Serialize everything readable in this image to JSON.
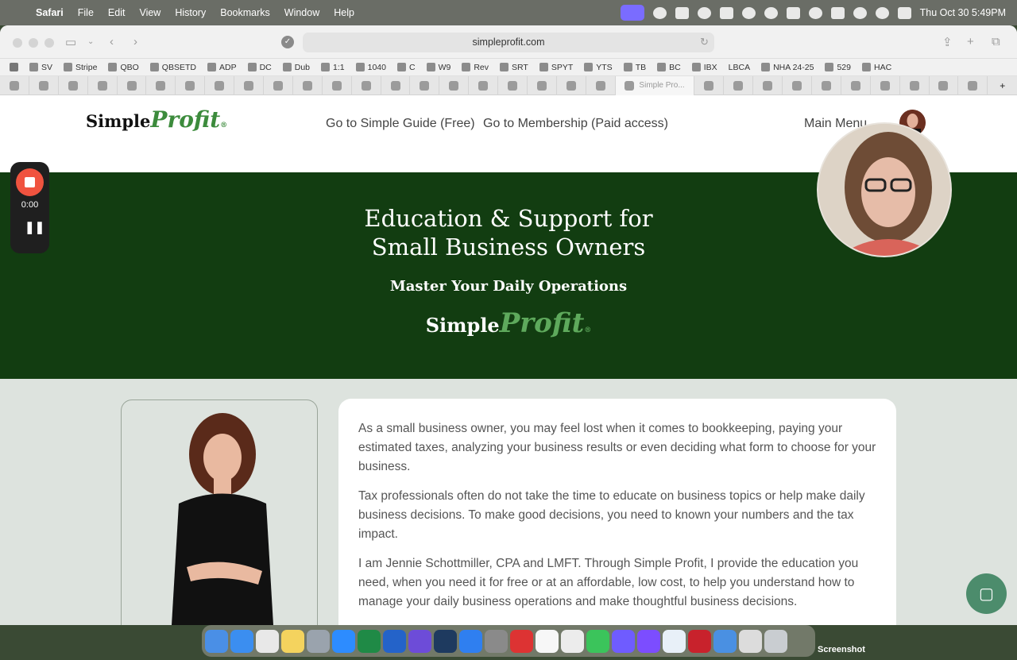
{
  "menubar": {
    "app_name": "Safari",
    "menus": [
      "File",
      "Edit",
      "View",
      "History",
      "Bookmarks",
      "Window",
      "Help"
    ],
    "clock": "Thu Oct 30  5:49PM"
  },
  "browser": {
    "url": "simpleprofit.com",
    "bookmarks": [
      "SV",
      "Stripe",
      "QBO",
      "QBSETD",
      "ADP",
      "DC",
      "Dub",
      "1:1",
      "1040",
      "C",
      "W9",
      "Rev",
      "SRT",
      "SPYT",
      "YTS",
      "TB",
      "BC",
      "IBX",
      "LBCA",
      "NHA 24-25",
      "529",
      "HAC"
    ],
    "active_tab_label": "Simple Pro..."
  },
  "site": {
    "logo_part1": "Simple",
    "logo_part2": "Profit",
    "logo_reg": "®",
    "nav_guide": "Go to Simple Guide (Free)",
    "nav_membership": "Go to Membership (Paid access)",
    "nav_main_menu": "Main Menu"
  },
  "hero": {
    "title_line1": "Education & Support for",
    "title_line2": "Small Business Owners",
    "subtitle": "Master Your Daily Operations"
  },
  "intro": {
    "paragraphs": [
      "As a small business owner, you may feel lost when it comes to bookkeeping, paying your estimated taxes, analyzing your business results or even deciding what form to choose for your business.",
      "Tax professionals often do not take the time to educate on business topics or help make daily business decisions. To make good decisions, you need to known your numbers and the tax impact.",
      "I am Jennie Schottmiller, CPA and LMFT. Through Simple Profit, I provide the education you need, when you need it for free or at an affordable, low cost, to help you understand how to manage your daily business operations and make thoughtful business decisions."
    ]
  },
  "recorder": {
    "time": "0:00"
  },
  "desktop": {
    "file_label": "Screenshot"
  },
  "colors": {
    "hero_bg": "#123d11",
    "brand_green": "#3c8b3c",
    "page_bg": "#dde3de",
    "chat_btn": "#4c8c6c"
  }
}
